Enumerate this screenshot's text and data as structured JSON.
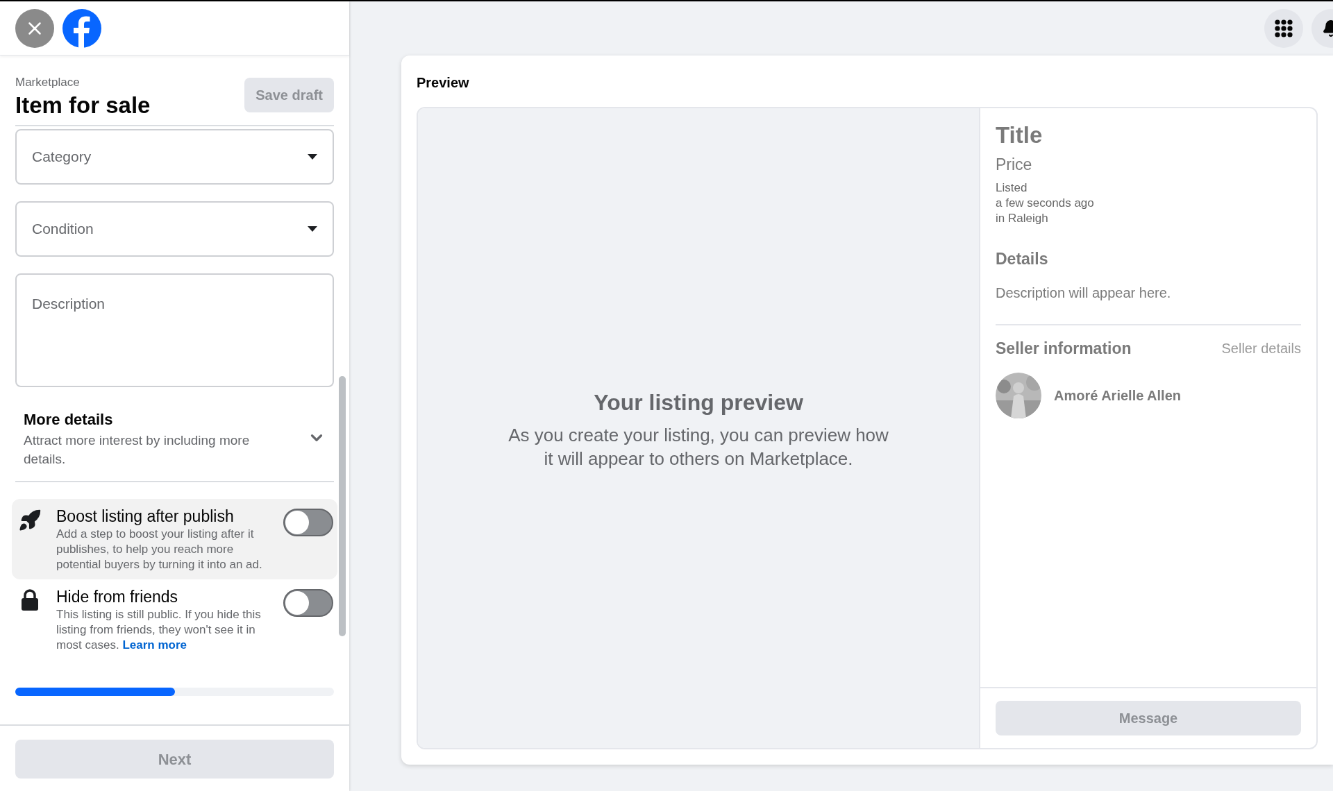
{
  "form": {
    "section": "Marketplace",
    "title": "Item for sale",
    "save_button": {
      "label": "Save draft",
      "disabled": true
    },
    "fields": [
      {
        "kind": "select",
        "placeholder": "Category"
      },
      {
        "kind": "select",
        "placeholder": "Condition"
      },
      {
        "kind": "textarea",
        "placeholder": "Description"
      }
    ],
    "more_details": {
      "title": "More details",
      "subtitle": "Attract more interest by including more details.",
      "expanded": false
    },
    "toggles": [
      {
        "kind": "boost",
        "title": "Boost listing after publish",
        "description": "Add a step to boost your listing after it publishes, to help you reach more potential buyers by turning it into an ad.",
        "highlighted": true,
        "on": false
      },
      {
        "kind": "visibility",
        "title": "Hide from friends",
        "description": "This listing is still public. If you hide this listing from friends, they won't see it in most cases.",
        "link": "Learn more",
        "highlighted": false,
        "on": false
      }
    ],
    "progress": {
      "level": 0.5
    },
    "next_button": {
      "label": "Next",
      "disabled": true
    }
  },
  "preview": {
    "title": "Preview",
    "empty_title": "Your listing preview",
    "empty_text": "As you create your listing, you can preview how it will appear to others on Marketplace.",
    "listing": {
      "title": "Title",
      "price": "Price",
      "listed": [
        "Listed",
        "a few seconds ago",
        "in Raleigh"
      ],
      "details_heading": "Details",
      "description": "Description will appear here.",
      "seller_heading": "Seller information",
      "seller_link": "Seller details",
      "seller_name": "Amoré Arielle Allen"
    },
    "message_button": {
      "label": "Message",
      "disabled": true
    }
  }
}
